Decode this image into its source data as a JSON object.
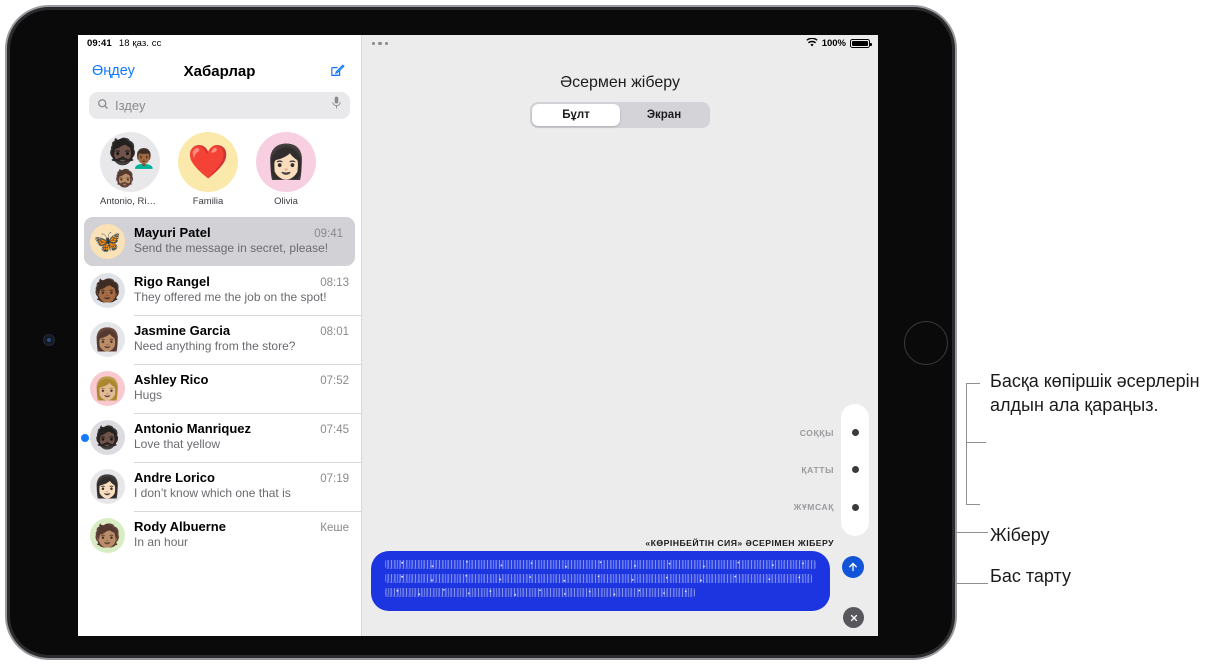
{
  "device": {
    "name": "iPad"
  },
  "sidebar": {
    "status": {
      "time": "09:41",
      "date": "18 қаз. сс"
    },
    "nav": {
      "edit_label": "Өңдеу",
      "title": "Хабарлар",
      "compose_icon": "compose-icon"
    },
    "search": {
      "placeholder": "Іздеу",
      "search_icon": "search-icon",
      "dictate_icon": "microphone-icon"
    },
    "pinned": [
      {
        "name": "Antonio, Rigo &...",
        "avatar_type": "group",
        "emoji1": "🧔🏿",
        "emoji2": "👨🏾‍🦱",
        "emoji3": "🧔🏽",
        "bg": "#e8e8ea"
      },
      {
        "name": "Familia",
        "avatar_type": "emoji",
        "emoji": "❤️",
        "bg": "#fbe9ac"
      },
      {
        "name": "Olivia",
        "avatar_type": "emoji",
        "emoji": "👩🏻",
        "bg": "#f8cfe1"
      }
    ],
    "conversations": [
      {
        "name": "Mayuri Patel",
        "time": "09:41",
        "preview": "Send the message in secret, please!",
        "avatar": "🦋",
        "avatar_bg": "#fbe2b6",
        "selected": true,
        "unread": false
      },
      {
        "name": "Rigo Rangel",
        "time": "08:13",
        "preview": "They offered me the job on the spot!",
        "avatar": "🧑🏾",
        "avatar_bg": "#dfe3e8",
        "selected": false,
        "unread": false
      },
      {
        "name": "Jasmine Garcia",
        "time": "08:01",
        "preview": "Need anything from the store?",
        "avatar": "👩🏽",
        "avatar_bg": "#e4e6ea",
        "selected": false,
        "unread": false
      },
      {
        "name": "Ashley Rico",
        "time": "07:52",
        "preview": "Hugs",
        "avatar": "👩🏼",
        "avatar_bg": "#f9c9cf",
        "selected": false,
        "unread": false
      },
      {
        "name": "Antonio Manriquez",
        "time": "07:45",
        "preview": "Love that yellow",
        "avatar": "🧔🏿",
        "avatar_bg": "#dcdce0",
        "selected": false,
        "unread": true
      },
      {
        "name": "Andre Lorico",
        "time": "07:19",
        "preview": "I don’t know which one that is",
        "avatar": "👩🏻",
        "avatar_bg": "#e7e7ea",
        "selected": false,
        "unread": false
      },
      {
        "name": "Rody Albuerne",
        "time": "Кеше",
        "preview": "In an hour",
        "avatar": "🧑🏽",
        "avatar_bg": "#d9edc4",
        "selected": false,
        "unread": false
      }
    ]
  },
  "main": {
    "status": {
      "menu_icon": "more-options-icon",
      "wifi_icon": "wifi-icon",
      "battery_label": "100%",
      "battery_icon": "battery-full-icon"
    },
    "effect_title": "Әсермен жіберу",
    "segments": [
      {
        "label": "Бұлт",
        "active": true
      },
      {
        "label": "Экран",
        "active": false
      }
    ],
    "effect_options": [
      "СОҚҚЫ",
      "ҚАТТЫ",
      "ЖҰМСАҚ"
    ],
    "ink_label": "«КӨРІНБЕЙТІН СИЯ» ӘСЕРІМЕН ЖІБЕРУ",
    "send_icon": "send-arrow-up-icon",
    "cancel_icon": "cancel-x-icon",
    "bubble_color": "#1c35e0"
  },
  "callouts": {
    "effects": "Басқа көпіршік әсерлерін алдын ала қараңыз.",
    "send": "Жіберу",
    "cancel": "Бас тарту"
  }
}
